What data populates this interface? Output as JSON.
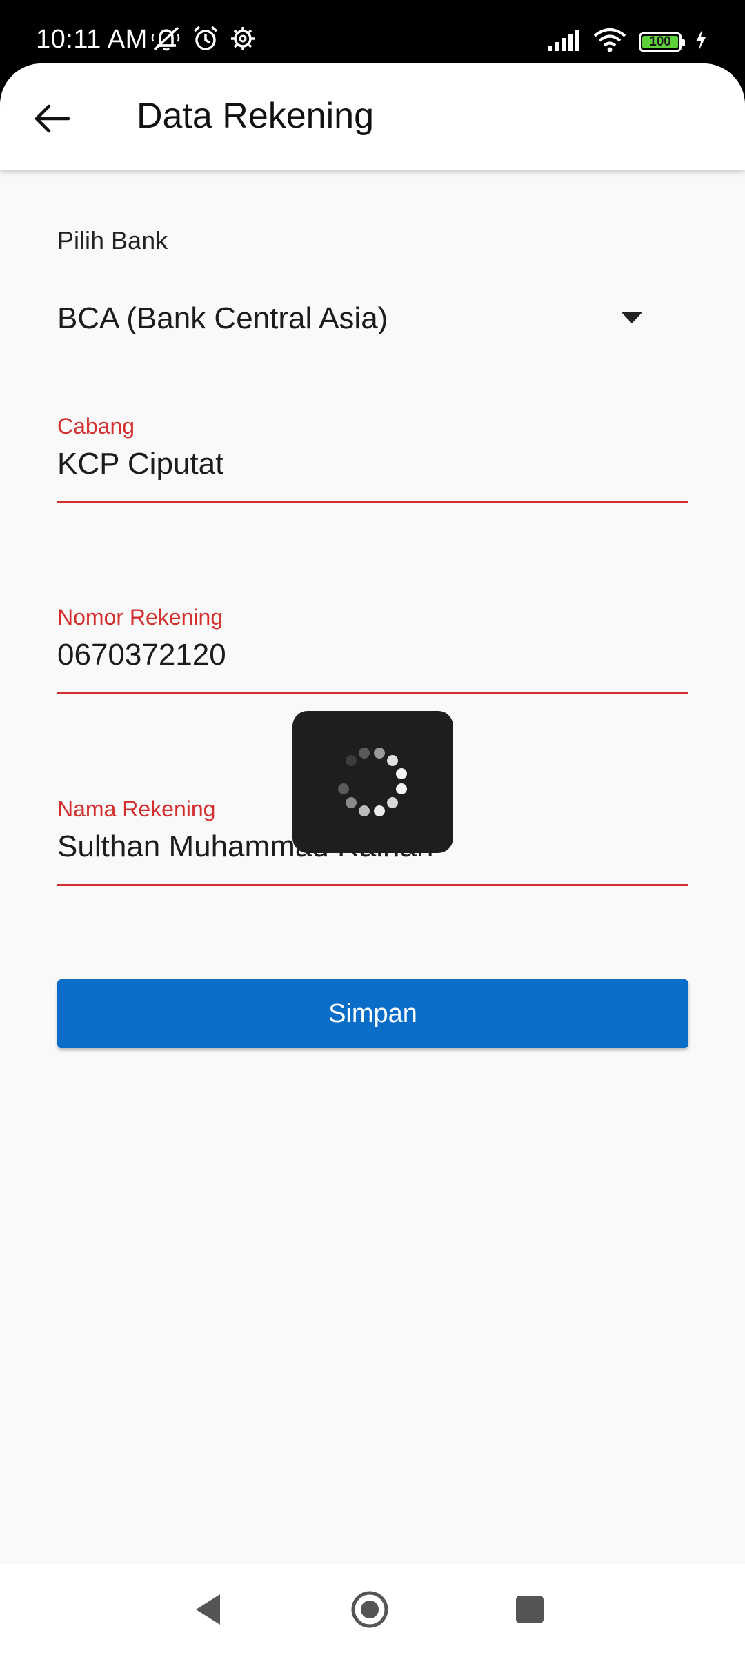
{
  "status_bar": {
    "time": "10:11 AM",
    "battery_level": "100",
    "left_icons": [
      "mute-notifications-icon",
      "alarm-icon",
      "settings-gear-icon"
    ],
    "right_icons": [
      "signal-icon",
      "wifi-icon",
      "battery-icon",
      "charging-bolt-icon"
    ],
    "battery_color": "#5fd13a"
  },
  "app_bar": {
    "title": "Data Rekening",
    "back_icon": "arrow-back-icon"
  },
  "form": {
    "bank": {
      "label": "Pilih Bank",
      "value": "BCA (Bank Central Asia)",
      "icon": "dropdown-arrow-icon"
    },
    "branch": {
      "label": "Cabang",
      "value": "KCP Ciputat"
    },
    "account_number": {
      "label": "Nomor Rekening",
      "value": "0670372120"
    },
    "account_name": {
      "label": "Nama Rekening",
      "value": "Sulthan Muhammad Raihan"
    },
    "submit_label": "Simpan",
    "accent_color": "#d32f2f",
    "button_color": "#0a6dc7"
  },
  "loading": {
    "visible": true,
    "icon": "spinner-icon"
  },
  "nav_bar": {
    "icons": [
      "nav-back-icon",
      "nav-home-icon",
      "nav-recents-icon"
    ]
  }
}
